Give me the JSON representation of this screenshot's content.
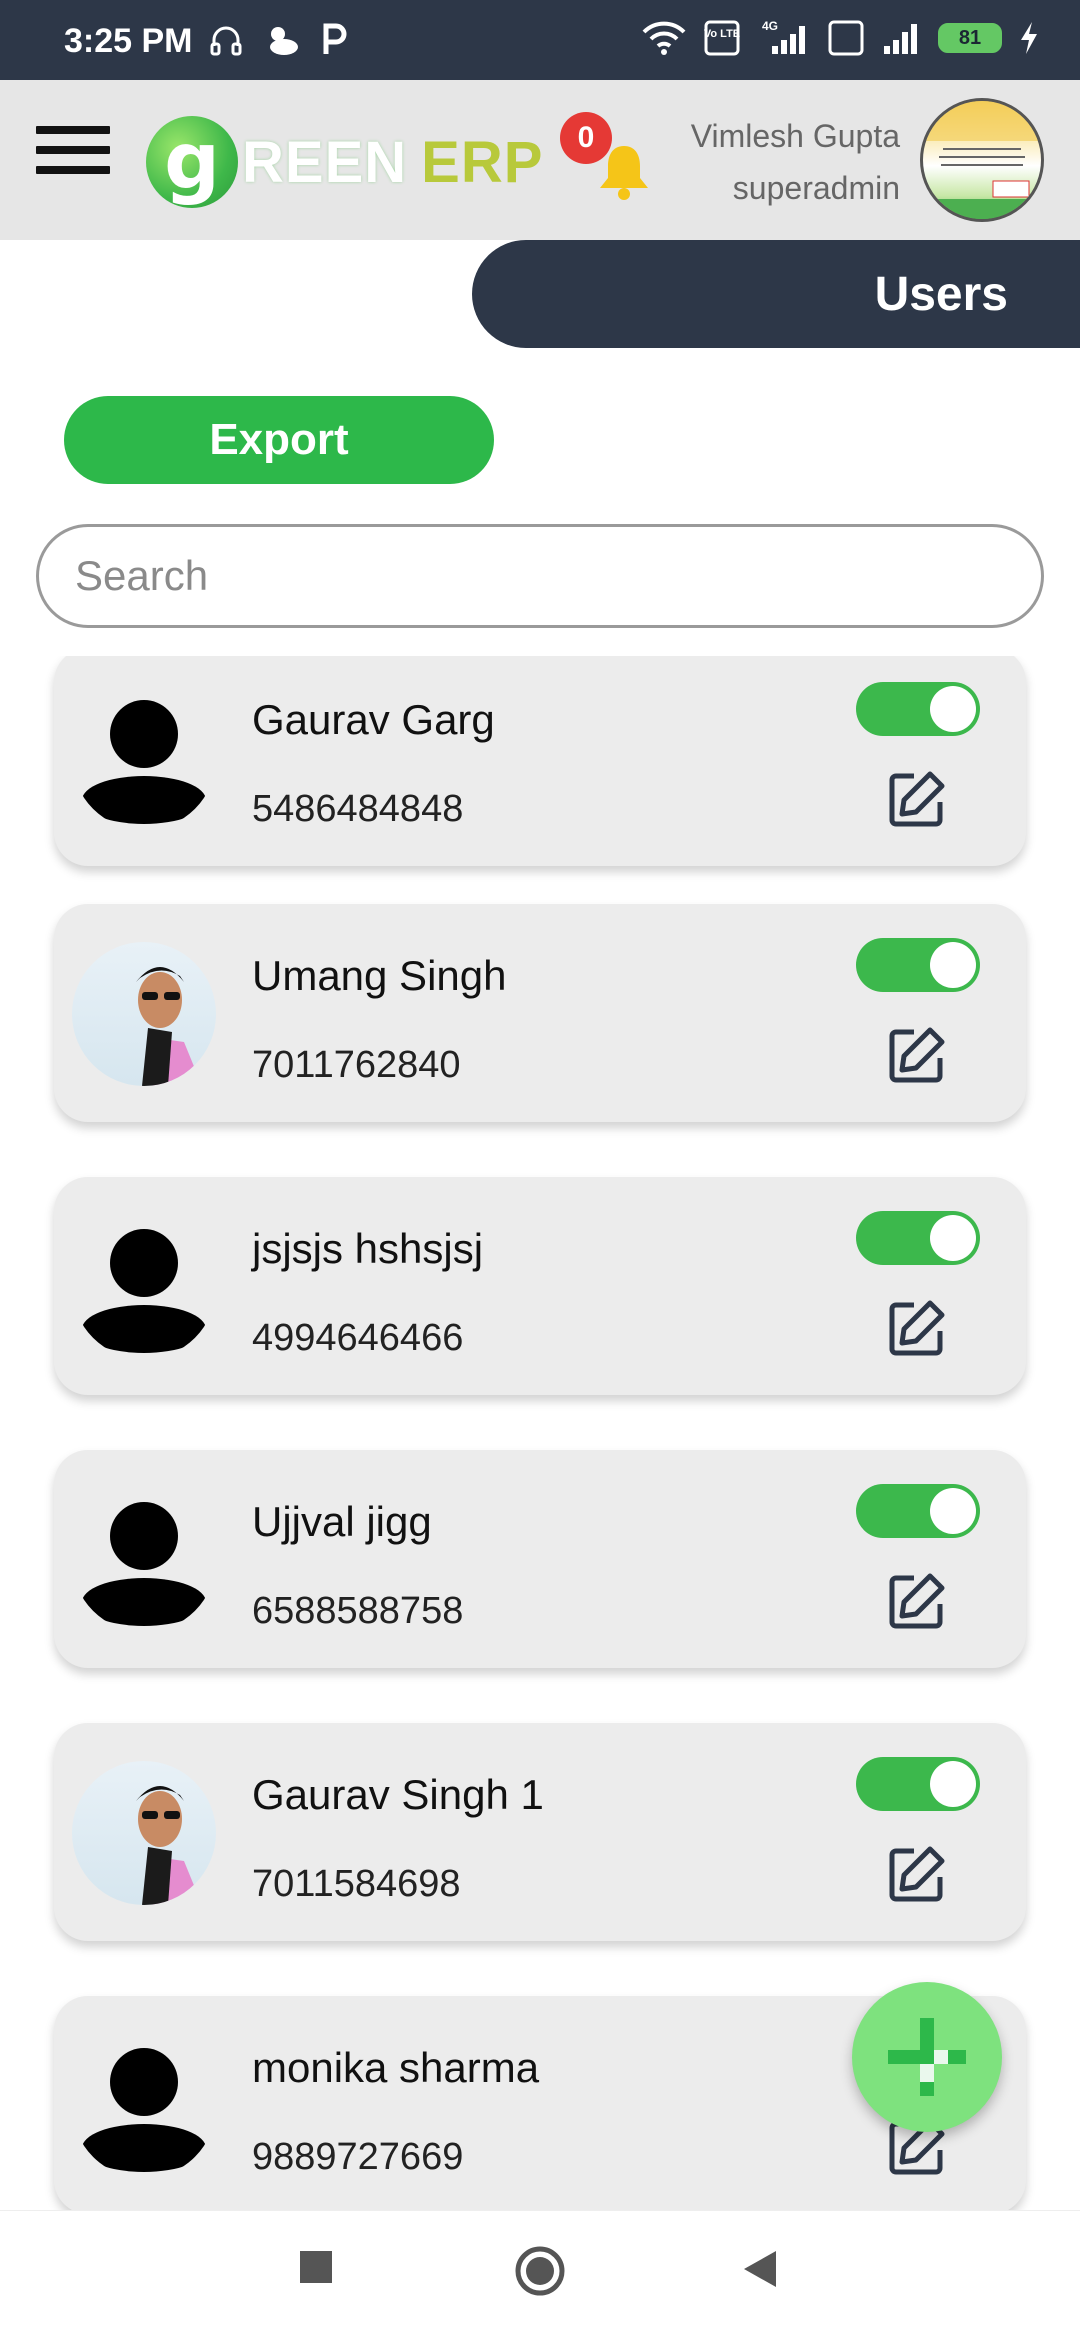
{
  "status_bar": {
    "time": "3:25 PM",
    "left_icons": [
      "headset-icon",
      "cloud-weather-icon",
      "parking-p-icon"
    ],
    "right_icons": [
      "wifi-icon",
      "volte-lte-icon",
      "4g-signal-icon",
      "volte-lte-icon",
      "signal-icon",
      "battery-icon",
      "charging-bolt-icon"
    ],
    "network_4g": "4G",
    "volte_label": "Vo LTE",
    "battery": "81"
  },
  "header": {
    "logo_letter": "g",
    "logo_reen": "REEN",
    "logo_erp": "ERP",
    "notification_count": "0",
    "user_name": "Vimlesh Gupta",
    "user_role": "superadmin"
  },
  "page": {
    "title": "Users",
    "export_label": "Export",
    "search_placeholder": "Search"
  },
  "users": [
    {
      "name": "Gaurav Garg",
      "phone": "5486484848",
      "avatar": "placeholder",
      "active": true
    },
    {
      "name": "Umang Singh",
      "phone": "7011762840",
      "avatar": "photo",
      "active": true
    },
    {
      "name": "jsjsjs hshsjsj",
      "phone": "4994646466",
      "avatar": "placeholder",
      "active": true
    },
    {
      "name": "Ujjval jigg",
      "phone": "6588588758",
      "avatar": "placeholder",
      "active": true
    },
    {
      "name": "Gaurav Singh 1",
      "phone": "7011584698",
      "avatar": "photo",
      "active": true
    },
    {
      "name": "monika sharma",
      "phone": "9889727669",
      "avatar": "placeholder",
      "active": true
    }
  ],
  "colors": {
    "header_dark": "#2d3748",
    "accent_green": "#2db84a",
    "toggle_green": "#3cb84c",
    "fab_green": "#7ee27e",
    "badge_red": "#e53935"
  }
}
